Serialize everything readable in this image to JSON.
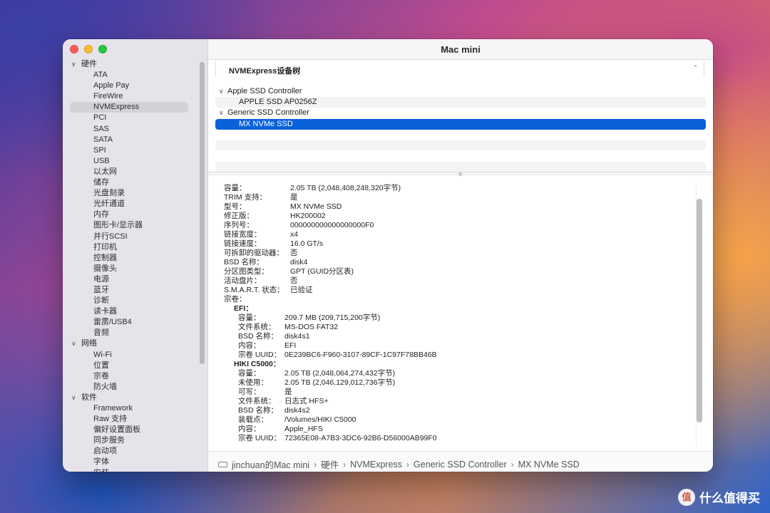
{
  "window": {
    "title": "Mac mini"
  },
  "sidebar": {
    "groups": [
      {
        "label": "硬件",
        "items": [
          "ATA",
          "Apple Pay",
          "FireWire",
          "NVMExpress",
          "PCI",
          "SAS",
          "SATA",
          "SPI",
          "USB",
          "以太网",
          "储存",
          "光盘刻录",
          "光纤通道",
          "内存",
          "图形卡/显示器",
          "并行SCSI",
          "打印机",
          "控制器",
          "摄像头",
          "电源",
          "蓝牙",
          "诊断",
          "读卡器",
          "雷雳/USB4",
          "音频"
        ]
      },
      {
        "label": "网络",
        "items": [
          "Wi-Fi",
          "位置",
          "宗卷",
          "防火墙"
        ]
      },
      {
        "label": "软件",
        "items": [
          "Framework",
          "Raw 支持",
          "偏好设置面板",
          "同步服务",
          "启动项",
          "字体",
          "安装"
        ]
      }
    ],
    "selected": "NVMExpress"
  },
  "section": {
    "title": "NVMExpress设备树"
  },
  "device_tree": {
    "controllers": [
      {
        "name": "Apple SSD Controller",
        "children": [
          "APPLE SSD AP0256Z"
        ]
      },
      {
        "name": "Generic SSD Controller",
        "children": [
          "MX NVMe SSD"
        ]
      }
    ],
    "selected": "MX NVMe SSD"
  },
  "details": {
    "rows": [
      {
        "k": "容量：",
        "v": "2.05 TB (2,048,408,248,320字节)"
      },
      {
        "k": "TRIM 支持：",
        "v": "是"
      },
      {
        "k": "型号：",
        "v": "MX NVMe SSD"
      },
      {
        "k": "修正版：",
        "v": "HK200002"
      },
      {
        "k": "序列号：",
        "v": "000000000000000000F0"
      },
      {
        "k": "链接宽度：",
        "v": "x4"
      },
      {
        "k": "链接速度：",
        "v": "16.0 GT/s"
      },
      {
        "k": "可拆卸的驱动器：",
        "v": "否"
      },
      {
        "k": "BSD 名称：",
        "v": "disk4"
      },
      {
        "k": "分区图类型：",
        "v": "GPT (GUID分区表)"
      },
      {
        "k": "活动盘片：",
        "v": "否"
      },
      {
        "k": "S.M.A.R.T. 状态：",
        "v": "已验证"
      }
    ],
    "volumes_label": "宗卷：",
    "volumes": [
      {
        "name": "EFI：",
        "rows": [
          {
            "k": "容量：",
            "v": "209.7 MB (209,715,200字节)"
          },
          {
            "k": "文件系统：",
            "v": "MS-DOS FAT32"
          },
          {
            "k": "BSD 名称：",
            "v": "disk4s1"
          },
          {
            "k": "内容：",
            "v": "EFI"
          },
          {
            "k": "宗卷 UUID：",
            "v": "0E239BC6-F960-3107-89CF-1C97F78BB46B"
          }
        ]
      },
      {
        "name": "HIKI C5000：",
        "rows": [
          {
            "k": "容量：",
            "v": "2.05 TB (2,048,064,274,432字节)"
          },
          {
            "k": "未使用：",
            "v": "2.05 TB (2,046,129,012,736字节)"
          },
          {
            "k": "可写：",
            "v": "是"
          },
          {
            "k": "文件系统：",
            "v": "日志式 HFS+"
          },
          {
            "k": "BSD 名称：",
            "v": "disk4s2"
          },
          {
            "k": "装载点：",
            "v": "/Volumes/HIKI C5000"
          },
          {
            "k": "内容：",
            "v": "Apple_HFS"
          },
          {
            "k": "宗卷 UUID：",
            "v": "72365E08-A7B3-3DC6-92B6-D56000AB99F0"
          }
        ]
      }
    ]
  },
  "breadcrumb": [
    "jinchuan的Mac mini",
    "硬件",
    "NVMExpress",
    "Generic SSD Controller",
    "MX NVMe SSD"
  ],
  "watermark": {
    "badge": "值",
    "text": "什么值得买"
  },
  "colors": {
    "selection": "#0a61d9",
    "sidebar_bg": "#e6e3ea"
  },
  "icons": {
    "group_toggle": "chevron-down-icon",
    "collapse": "chevron-up-icon",
    "computer": "computer-icon"
  }
}
